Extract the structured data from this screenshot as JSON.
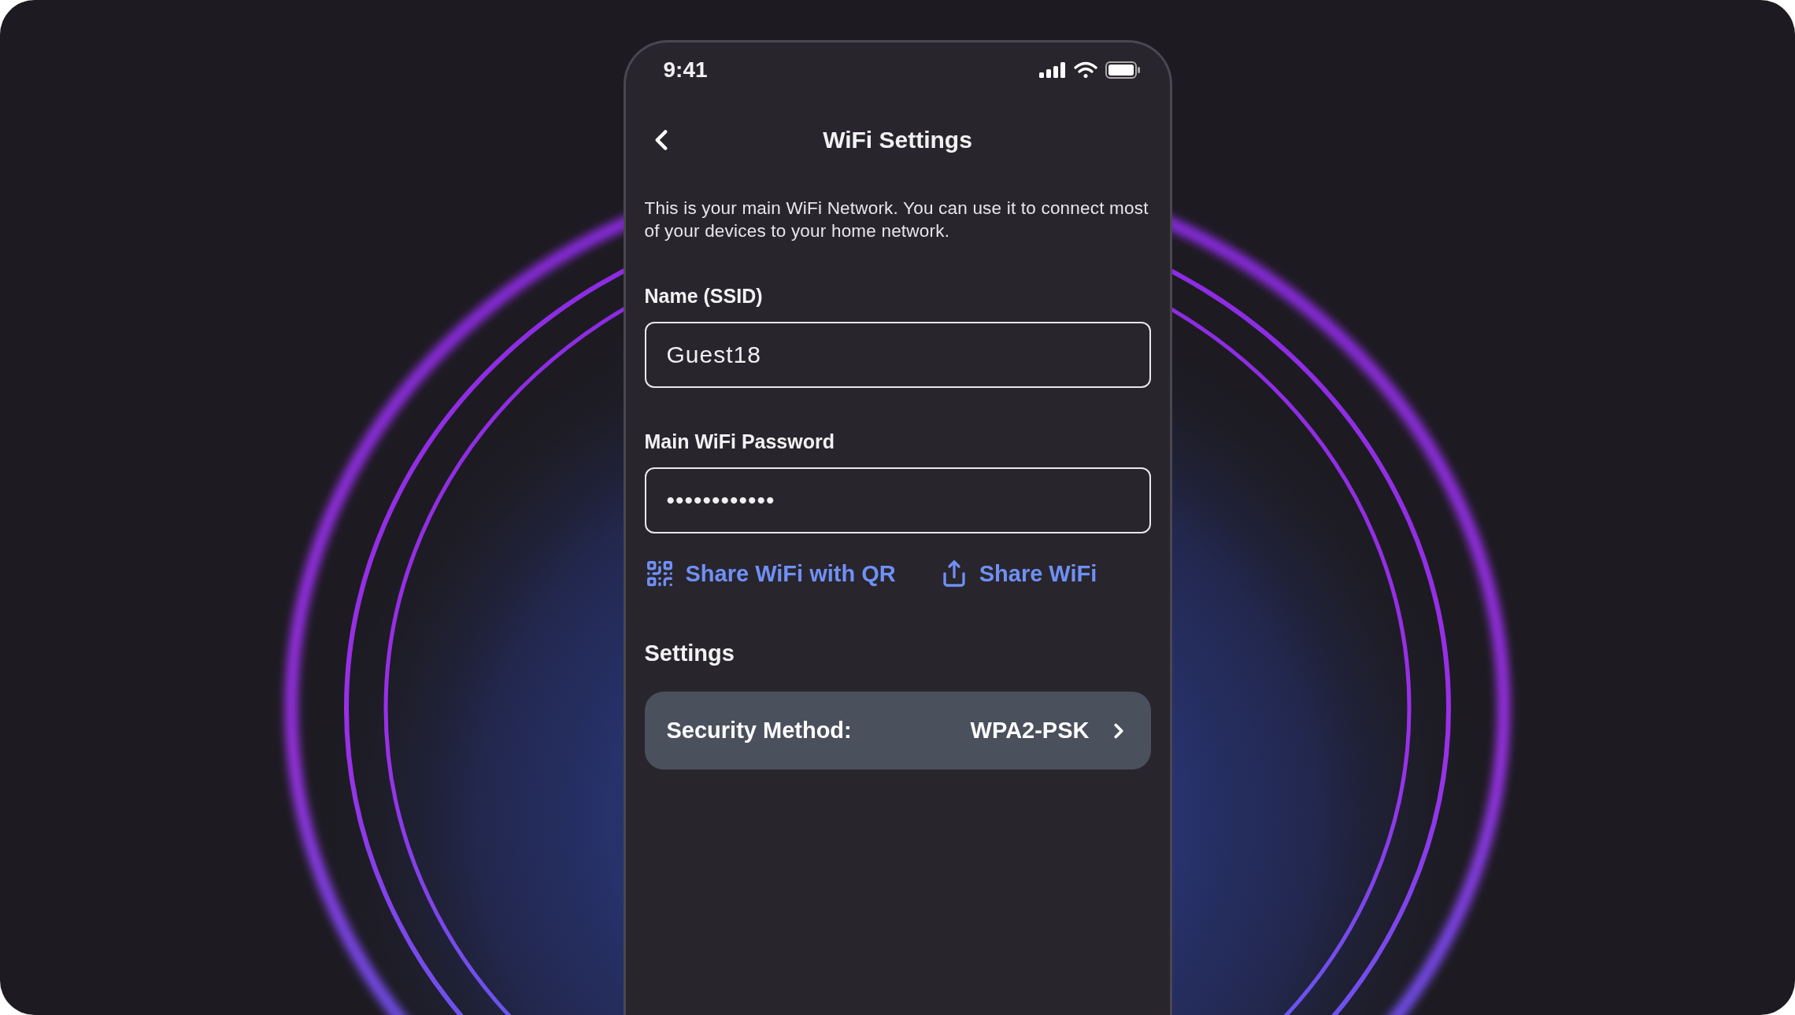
{
  "status_bar": {
    "time": "9:41"
  },
  "nav": {
    "title": "WiFi Settings"
  },
  "description": "This is your main WiFi Network. You can use it to connect most of your devices to your home network.",
  "fields": [
    {
      "label": "Name (SSID)",
      "value": "Guest18"
    },
    {
      "label": "Main WiFi Password",
      "value": "••••••••••••"
    }
  ],
  "share_actions": [
    {
      "kind": "qr",
      "label": "Share WiFi with QR"
    },
    {
      "kind": "share",
      "label": "Share WiFi"
    }
  ],
  "settings": {
    "heading": "Settings",
    "items": [
      {
        "label": "Security Method:",
        "value": "WPA2-PSK"
      }
    ]
  }
}
